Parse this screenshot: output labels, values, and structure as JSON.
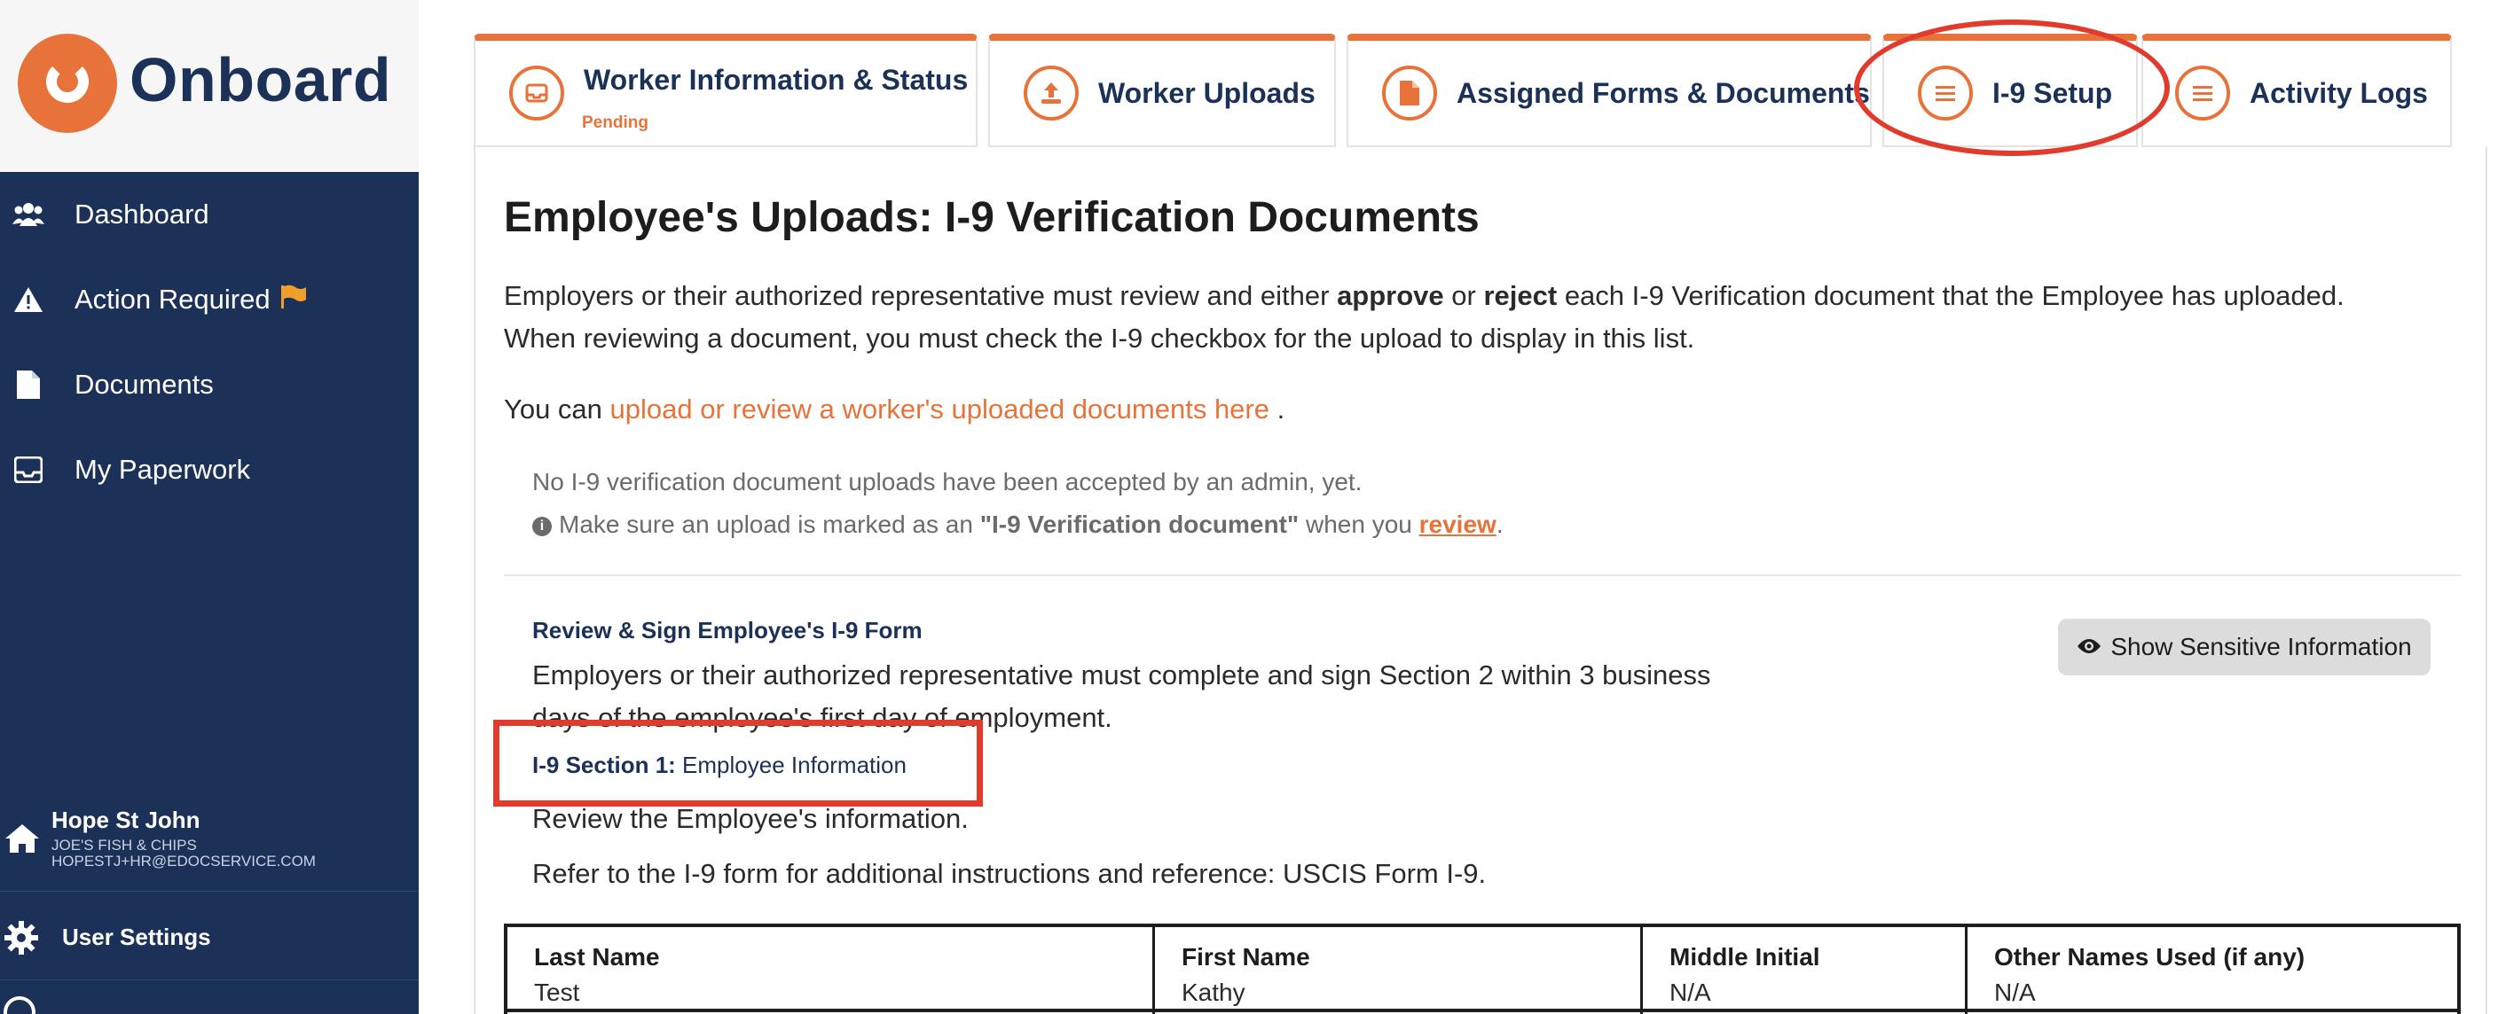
{
  "brand": {
    "name": "Onboard",
    "accent": "#e8733a",
    "navy": "#1b3157"
  },
  "sidebar": {
    "items": [
      {
        "label": "Dashboard",
        "icon": "users-icon"
      },
      {
        "label": "Action Required",
        "icon": "warning-icon"
      },
      {
        "label": "Documents",
        "icon": "document-icon"
      },
      {
        "label": "My Paperwork",
        "icon": "inbox-icon"
      }
    ],
    "user": {
      "name": "Hope St John",
      "company": "JOE'S FISH & CHIPS",
      "email": "HOPESTJ+HR@EDOCSERVICE.COM"
    },
    "settings_label": "User Settings"
  },
  "tabs": [
    {
      "label": "Worker Information & Status",
      "sub": "Pending",
      "icon": "inbox-icon"
    },
    {
      "label": "Worker Uploads",
      "icon": "upload-icon"
    },
    {
      "label": "Assigned Forms & Documents",
      "icon": "document-icon"
    },
    {
      "label": "I-9 Setup",
      "icon": "list-icon"
    },
    {
      "label": "Activity Logs",
      "icon": "list-icon"
    }
  ],
  "main": {
    "title": "Employee's Uploads: I-9 Verification Documents",
    "intro": {
      "part1": "Employers or their authorized representative must review and either ",
      "approve": "approve",
      "or": " or ",
      "reject": "reject",
      "part2": " each I-9 Verification document that the Employee has uploaded.",
      "line2": "When reviewing a document, you must check the I-9 checkbox for the upload to display in this list."
    },
    "upload_line": {
      "prefix": "You can ",
      "link1": "upload",
      "mid": " or review a worker's uploaded documents here",
      "suffix": " ."
    },
    "notice": {
      "line1": "No I-9 verification document uploads have been accepted by an admin, yet.",
      "line2_prefix": "Make sure an upload is marked as an ",
      "line2_bold": "\"I-9 Verification document\"",
      "line2_mid": " when you ",
      "line2_link": "review",
      "line2_suffix": "."
    },
    "review_section": {
      "heading": "Review & Sign Employee's I-9 Form",
      "text1": "Employers or their authorized representative must complete and sign Section 2 within 3 business",
      "text2": "days of the employee's first day of employment.",
      "show_button": "Show Sensitive Information"
    },
    "section1": {
      "heading_bold": "I-9 Section 1:",
      "heading_norm": " Employee Information",
      "text1": "Review the Employee's information.",
      "text2": "Refer to the I-9 form for additional instructions and reference: USCIS Form I-9."
    },
    "table": {
      "columns": [
        {
          "label": "Last Name",
          "value": "Test"
        },
        {
          "label": "First Name",
          "value": "Kathy"
        },
        {
          "label": "Middle Initial",
          "value": "N/A"
        },
        {
          "label": "Other Names Used (if any)",
          "value": "N/A"
        }
      ]
    }
  }
}
